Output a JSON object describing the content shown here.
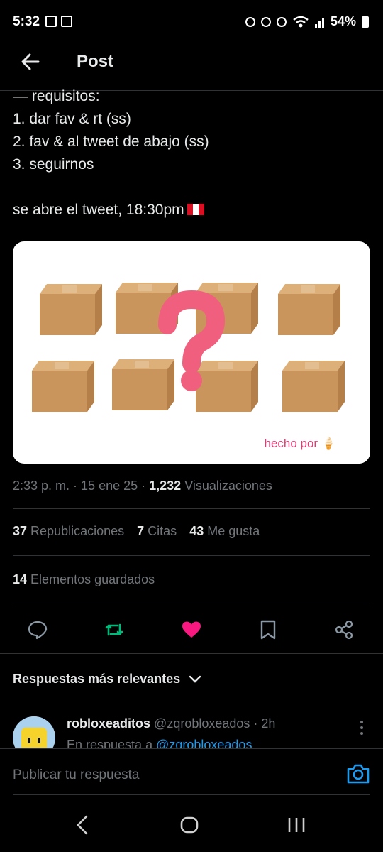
{
  "status_bar": {
    "time": "5:32",
    "battery": "54%"
  },
  "header": {
    "title": "Post"
  },
  "tweet": {
    "text": "— requisitos:\n1. dar fav & rt (ss)\n2. fav & al tweet de abajo (ss)\n3. seguirnos\n\nse abre el tweet, 18:30pm",
    "media_caption": "hecho por 🍦",
    "time": "2:33 p. m.",
    "date": "15 ene 25",
    "views_count": "1,232",
    "views_label": "Visualizaciones"
  },
  "stats": {
    "reposts_count": "37",
    "reposts_label": "Republicaciones",
    "quotes_count": "7",
    "quotes_label": "Citas",
    "likes_count": "43",
    "likes_label": "Me gusta",
    "bookmarks_count": "14",
    "bookmarks_label": "Elementos guardados"
  },
  "replies": {
    "sort_label": "Respuestas más relevantes",
    "first": {
      "name": "robloxeaditos",
      "handle": "@zqrobloxeados",
      "age": "· 2h",
      "in_reply_prefix": "En respuesta a",
      "in_reply_handle": "@zqrobloxeados"
    }
  },
  "compose": {
    "placeholder": "Publicar tu respuesta"
  },
  "colors": {
    "accent": "#1d9bf0",
    "retweet": "#00ba7c",
    "like": "#f91880"
  }
}
